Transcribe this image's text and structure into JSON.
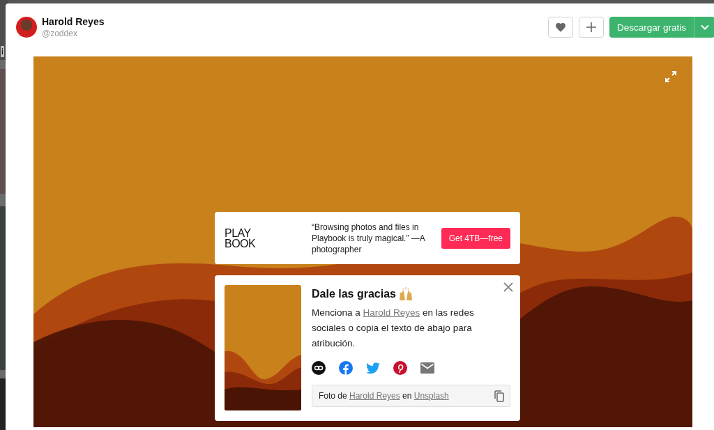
{
  "backdrop": {
    "text_fragment": "i"
  },
  "header": {
    "author": {
      "name": "Harold Reyes",
      "username": "@zoddex"
    },
    "download_button": "Descargar gratis"
  },
  "ad": {
    "logo_lines": [
      "PLAY",
      "BOOK"
    ],
    "quote": "“Browsing photos and files in Playbook is truly magical.” —A photographer",
    "cta": "Get 4TB—free"
  },
  "thanks": {
    "title": "Dale las gracias",
    "text_before": "Menciona a ",
    "author_link": "Harold Reyes",
    "text_after": " en las redes sociales o copia el texto de abajo para atribución.",
    "share": [
      {
        "kind": "link"
      },
      {
        "kind": "facebook"
      },
      {
        "kind": "twitter"
      },
      {
        "kind": "pinterest"
      },
      {
        "kind": "email"
      }
    ],
    "attribution": {
      "prefix": "Foto de ",
      "author": "Harold Reyes",
      "middle": " en ",
      "site": "Unsplash"
    }
  }
}
